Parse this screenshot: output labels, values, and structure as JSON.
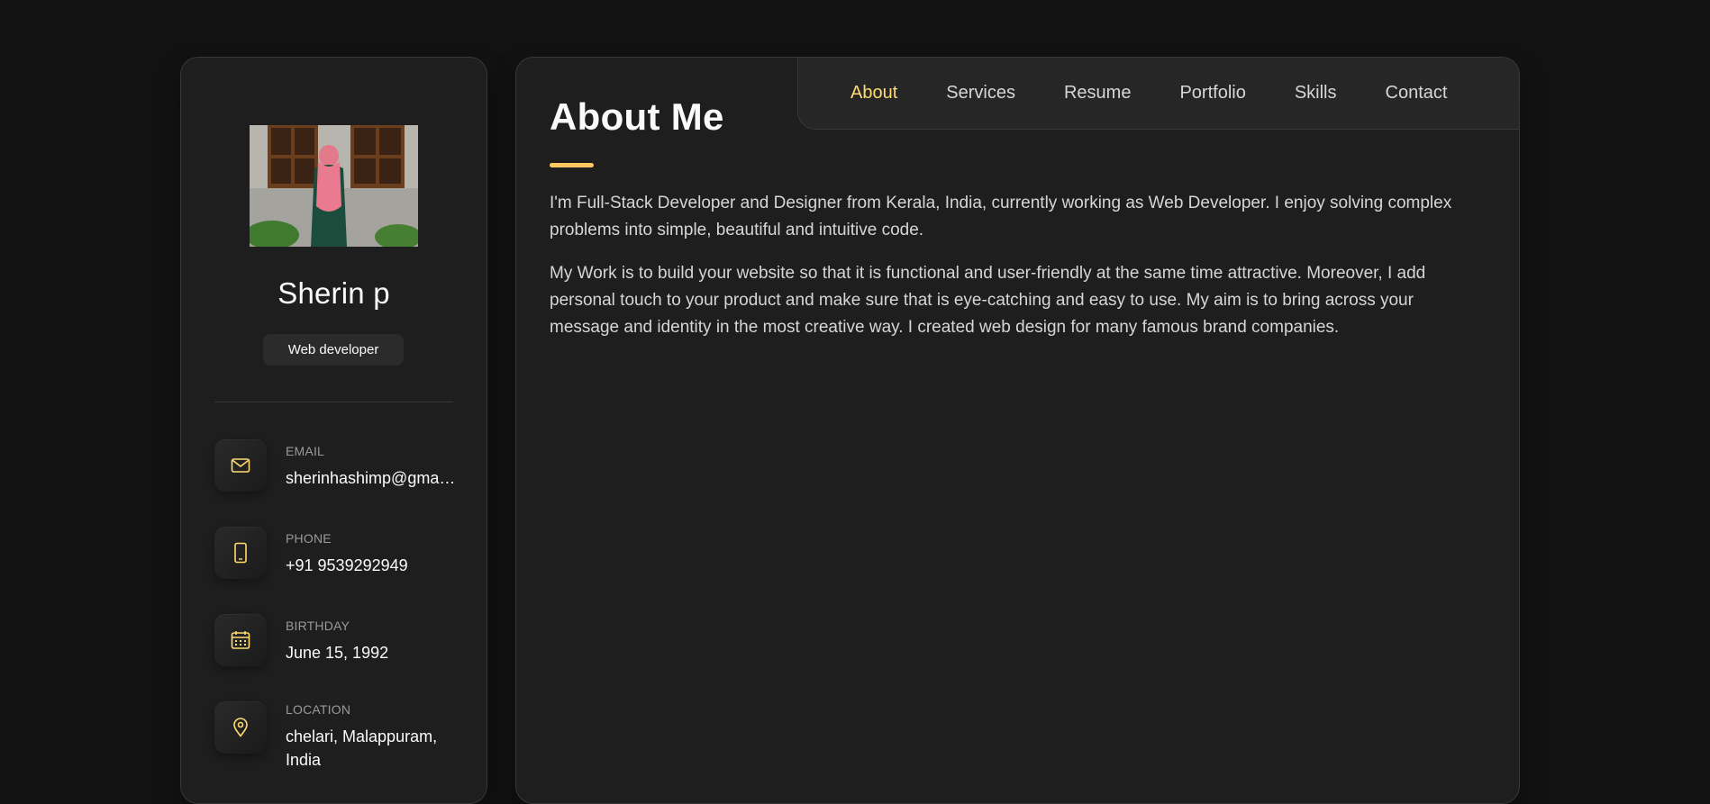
{
  "sidebar": {
    "name": "Sherin p",
    "role": "Web developer",
    "contacts": [
      {
        "title": "Email",
        "value": "sherinhashimp@gmail.com",
        "icon": "mail-icon"
      },
      {
        "title": "Phone",
        "value": "+91 9539292949",
        "icon": "phone-icon"
      },
      {
        "title": "Birthday",
        "value": "June 15, 1992",
        "icon": "calendar-icon"
      },
      {
        "title": "Location",
        "value": "chelari, Malappuram, India",
        "icon": "location-pin-icon"
      }
    ]
  },
  "navbar": {
    "items": [
      "About",
      "Services",
      "Resume",
      "Portfolio",
      "Skills",
      "Contact"
    ],
    "active": "About"
  },
  "about": {
    "title": "About Me",
    "paragraphs": [
      "I'm Full-Stack Developer and Designer from Kerala, India, currently working as Web Developer. I enjoy solving complex problems into simple, beautiful and intuitive code.",
      "My Work is to build your website so that it is functional and user-friendly at the same time attractive. Moreover, I add personal touch to your product and make sure that is eye-catching and easy to use. My aim is to bring across your message and identity in the most creative way. I created web design for many famous brand companies."
    ]
  },
  "colors": {
    "background": "#121212",
    "panel": "#1e1e1f",
    "accent": "#ffdb70",
    "text": "#fafafa",
    "muted_text": "#d6d6d6"
  }
}
